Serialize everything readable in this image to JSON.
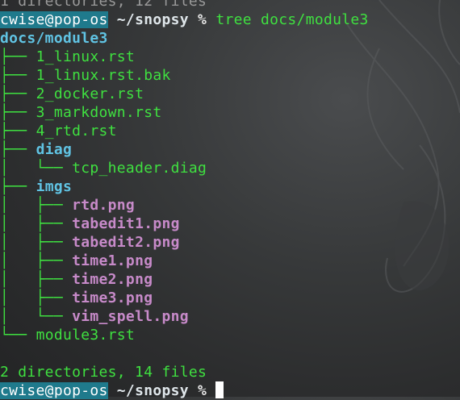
{
  "prompt": {
    "user_host": "cwise@pop-os",
    "path": "~/snopsy",
    "symbol": "%"
  },
  "command": "tree docs/module3",
  "partial_top_line": "1 directories, 12 files",
  "tree": {
    "root": "docs/module3",
    "entries": [
      {
        "prefix": "├── ",
        "name": "1_linux.rst",
        "kind": "file"
      },
      {
        "prefix": "├── ",
        "name": "1_linux.rst.bak",
        "kind": "file"
      },
      {
        "prefix": "├── ",
        "name": "2_docker.rst",
        "kind": "file"
      },
      {
        "prefix": "├── ",
        "name": "3_markdown.rst",
        "kind": "file"
      },
      {
        "prefix": "├── ",
        "name": "4_rtd.rst",
        "kind": "file"
      },
      {
        "prefix": "├── ",
        "name": "diag",
        "kind": "dir"
      },
      {
        "prefix": "│   └── ",
        "name": "tcp_header.diag",
        "kind": "file"
      },
      {
        "prefix": "├── ",
        "name": "imgs",
        "kind": "dir"
      },
      {
        "prefix": "│   ├── ",
        "name": "rtd.png",
        "kind": "image"
      },
      {
        "prefix": "│   ├── ",
        "name": "tabedit1.png",
        "kind": "image"
      },
      {
        "prefix": "│   ├── ",
        "name": "tabedit2.png",
        "kind": "image"
      },
      {
        "prefix": "│   ├── ",
        "name": "time1.png",
        "kind": "image"
      },
      {
        "prefix": "│   ├── ",
        "name": "time2.png",
        "kind": "image"
      },
      {
        "prefix": "│   ├── ",
        "name": "time3.png",
        "kind": "image"
      },
      {
        "prefix": "│   └── ",
        "name": "vim_spell.png",
        "kind": "image"
      },
      {
        "prefix": "└── ",
        "name": "module3.rst",
        "kind": "file"
      }
    ]
  },
  "summary": "2 directories, 14 files",
  "colors": {
    "prompt_bg": "#1f7a8c",
    "green": "#3fe040",
    "dir_blue": "#60c3e3",
    "image_magenta": "#c78ac9"
  }
}
